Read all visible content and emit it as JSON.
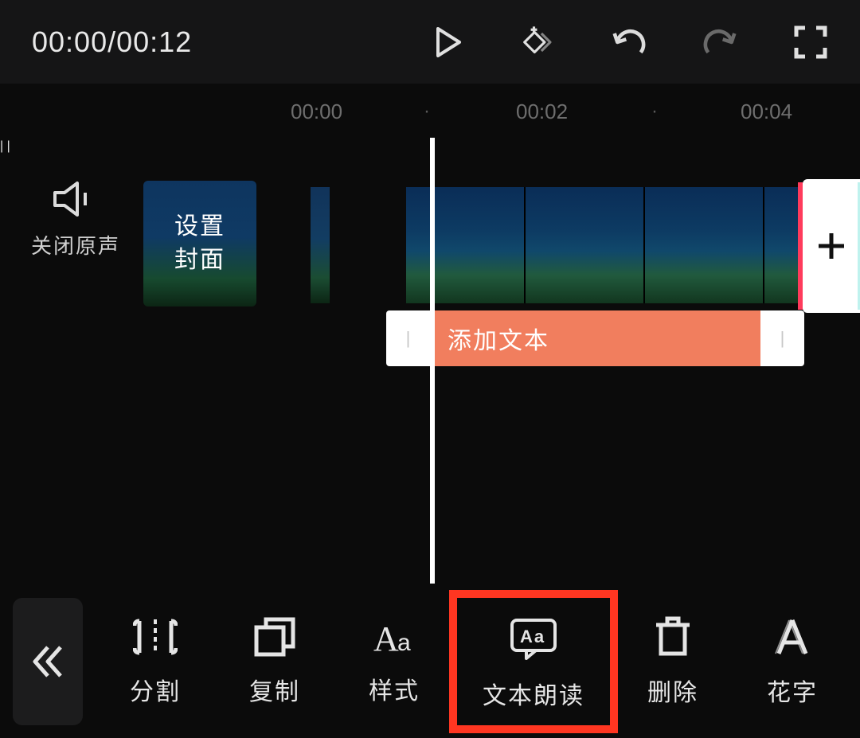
{
  "topbar": {
    "time": "00:00/00:12"
  },
  "ruler": {
    "t0": "00:00",
    "t1": "00:02",
    "t2": "00:04"
  },
  "timeline": {
    "mute_label": "关闭原声",
    "cover_label": "设置\n封面",
    "text_clip_label": "添加文本"
  },
  "tools": {
    "split": "分割",
    "copy": "复制",
    "style": "样式",
    "tts": "文本朗读",
    "delete": "删除",
    "fancy": "花字"
  }
}
